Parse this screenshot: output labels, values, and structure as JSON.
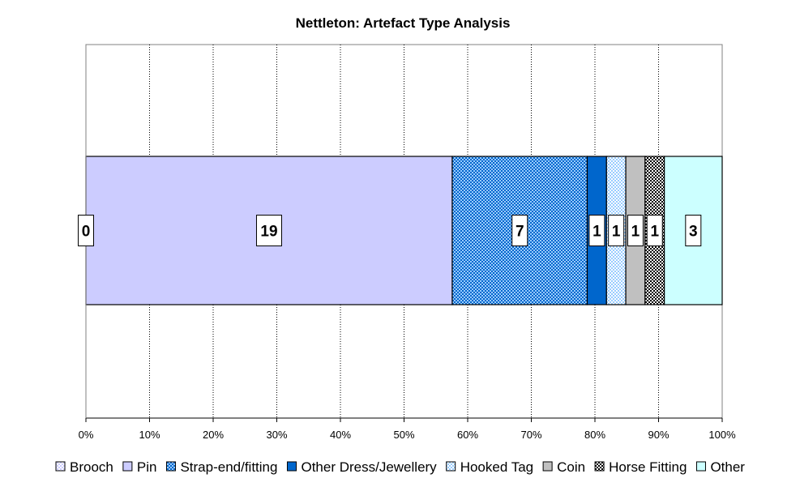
{
  "chart_data": {
    "type": "bar",
    "orientation": "horizontal",
    "stacking": "percent",
    "title": "Nettleton: Artefact Type Analysis",
    "xlabel": "",
    "ylabel": "",
    "xlim": [
      0,
      100
    ],
    "x_ticks": [
      "0%",
      "10%",
      "20%",
      "30%",
      "40%",
      "50%",
      "60%",
      "70%",
      "80%",
      "90%",
      "100%"
    ],
    "grid": "vertical dotted",
    "legend_position": "bottom",
    "categories": [
      ""
    ],
    "series": [
      {
        "name": "Brooch",
        "values": [
          0
        ],
        "color": "#ccccff",
        "pattern": "checker-light"
      },
      {
        "name": "Pin",
        "values": [
          19
        ],
        "color": "#ccccff",
        "pattern": "solid"
      },
      {
        "name": "Strap-end/fitting",
        "values": [
          7
        ],
        "color": "#0066cc",
        "pattern": "checker-blue"
      },
      {
        "name": "Other Dress/Jewellery",
        "values": [
          1
        ],
        "color": "#0066cc",
        "pattern": "solid"
      },
      {
        "name": "Hooked Tag",
        "values": [
          1
        ],
        "color": "#99ccff",
        "pattern": "checker-lightblue"
      },
      {
        "name": "Coin",
        "values": [
          1
        ],
        "color": "#c0c0c0",
        "pattern": "solid"
      },
      {
        "name": "Horse Fitting",
        "values": [
          1
        ],
        "color": "#000000",
        "pattern": "checker-black"
      },
      {
        "name": "Other",
        "values": [
          3
        ],
        "color": "#ccffff",
        "pattern": "solid"
      }
    ]
  }
}
